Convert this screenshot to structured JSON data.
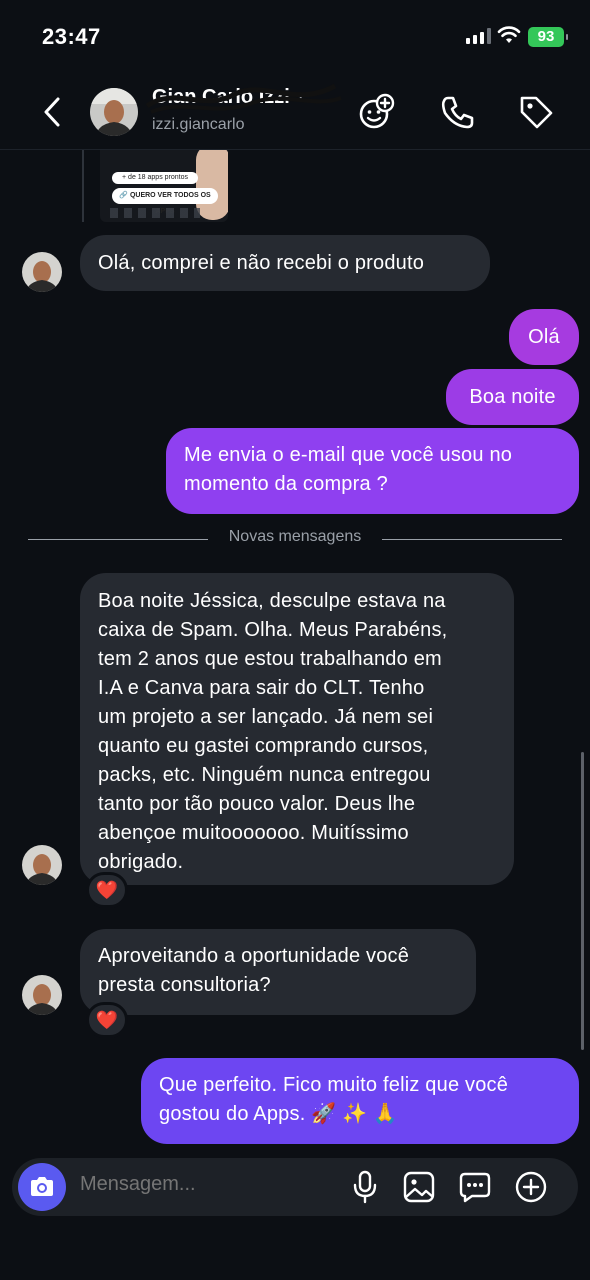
{
  "status": {
    "time": "23:47",
    "battery": "93"
  },
  "header": {
    "contact_name": "Gian Carlo Izzi",
    "username": "izzi.giancarlo"
  },
  "thumbnail": {
    "line1": "+ de 18 apps prontos",
    "line2": "🔗 QUERO VER TODOS OS APPS"
  },
  "messages": {
    "m1": "Olá,  comprei e não recebi o produto",
    "m2": "Olá",
    "m3": "Boa noite",
    "m4_l1": "Me envia o e-mail que você usou no",
    "m4_l2": "momento da compra ?",
    "divider": "Novas mensagens",
    "m5": [
      "Boa noite Jéssica, desculpe estava na",
      "caixa de Spam. Olha. Meus Parabéns,",
      "tem 2 anos que estou trabalhando em",
      "I.A e Canva para sair do CLT. Tenho",
      "um projeto a ser lançado. Já nem sei",
      "quanto eu gastei comprando cursos,",
      "packs, etc. Ninguém nunca entregou",
      "tanto por tão pouco valor. Deus lhe",
      "abençoe muitooooooo. Muitíssimo",
      "obrigado."
    ],
    "m6_l1": "Aproveitando a oportunidade você",
    "m6_l2": "presta consultoria?",
    "m7_l1": "Que perfeito. Fico muito feliz que você",
    "m7_l2": "gostou do Apps. 🚀 ✨ 🙏",
    "reaction": "❤️"
  },
  "composer": {
    "placeholder": "Mensagem..."
  },
  "colors": {
    "bubble_in": "#262a31",
    "bubble_out_1": "#a63be0",
    "bubble_out_2": "#8f40f0",
    "bubble_out_3": "#6d46f2",
    "background": "#0c0f14"
  },
  "icons": [
    "back-arrow-icon",
    "sticker-icon",
    "phone-icon",
    "tag-icon",
    "camera-icon",
    "microphone-icon",
    "gallery-icon",
    "chat-bubble-icon",
    "plus-circle-icon"
  ]
}
